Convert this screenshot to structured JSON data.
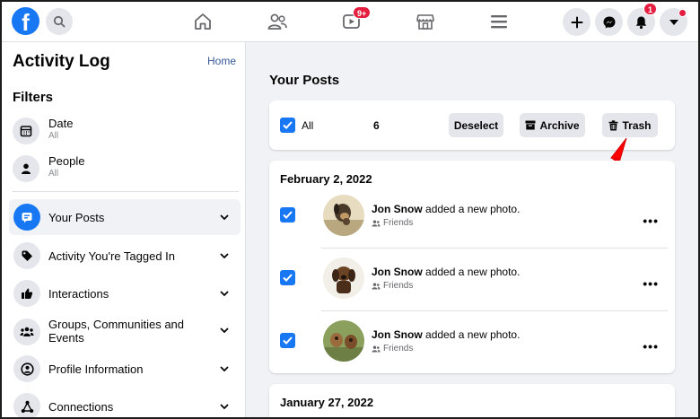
{
  "topbar": {
    "logo": "f",
    "watch_badge": "9+",
    "notif_badge": "1",
    "icons": [
      "search-icon",
      "home-icon",
      "friends-icon",
      "watch-icon",
      "marketplace-icon",
      "menu-icon",
      "plus-icon",
      "messenger-icon",
      "bell-icon",
      "caret-down-icon"
    ]
  },
  "sidebar": {
    "title": "Activity Log",
    "home_link": "Home",
    "filters_heading": "Filters",
    "filters": [
      {
        "label": "Date",
        "sub": "All",
        "icon": "calendar-icon"
      },
      {
        "label": "People",
        "sub": "All",
        "icon": "person-icon"
      }
    ],
    "categories": [
      {
        "label": "Your Posts",
        "icon": "posts-icon",
        "active": true
      },
      {
        "label": "Activity You're Tagged In",
        "icon": "tag-icon"
      },
      {
        "label": "Interactions",
        "icon": "thumbs-up-icon"
      },
      {
        "label": "Groups, Communities and Events",
        "icon": "groups-icon"
      },
      {
        "label": "Profile Information",
        "icon": "profile-icon"
      },
      {
        "label": "Connections",
        "icon": "connections-icon"
      }
    ]
  },
  "main": {
    "title": "Your Posts",
    "toolbar": {
      "all_label": "All",
      "count": "6",
      "deselect_label": "Deselect",
      "archive_label": "Archive",
      "trash_label": "Trash"
    },
    "groups": [
      {
        "date": "February 2, 2022",
        "posts": [
          {
            "author": "Jon Snow",
            "action": "added a new photo.",
            "audience": "Friends"
          },
          {
            "author": "Jon Snow",
            "action": "added a new photo.",
            "audience": "Friends"
          },
          {
            "author": "Jon Snow",
            "action": "added a new photo.",
            "audience": "Friends"
          }
        ]
      },
      {
        "date": "January 27, 2022",
        "posts": []
      }
    ]
  },
  "colors": {
    "accent": "#1877f2",
    "badge": "#e41e3f",
    "arrow": "#ff0000"
  }
}
